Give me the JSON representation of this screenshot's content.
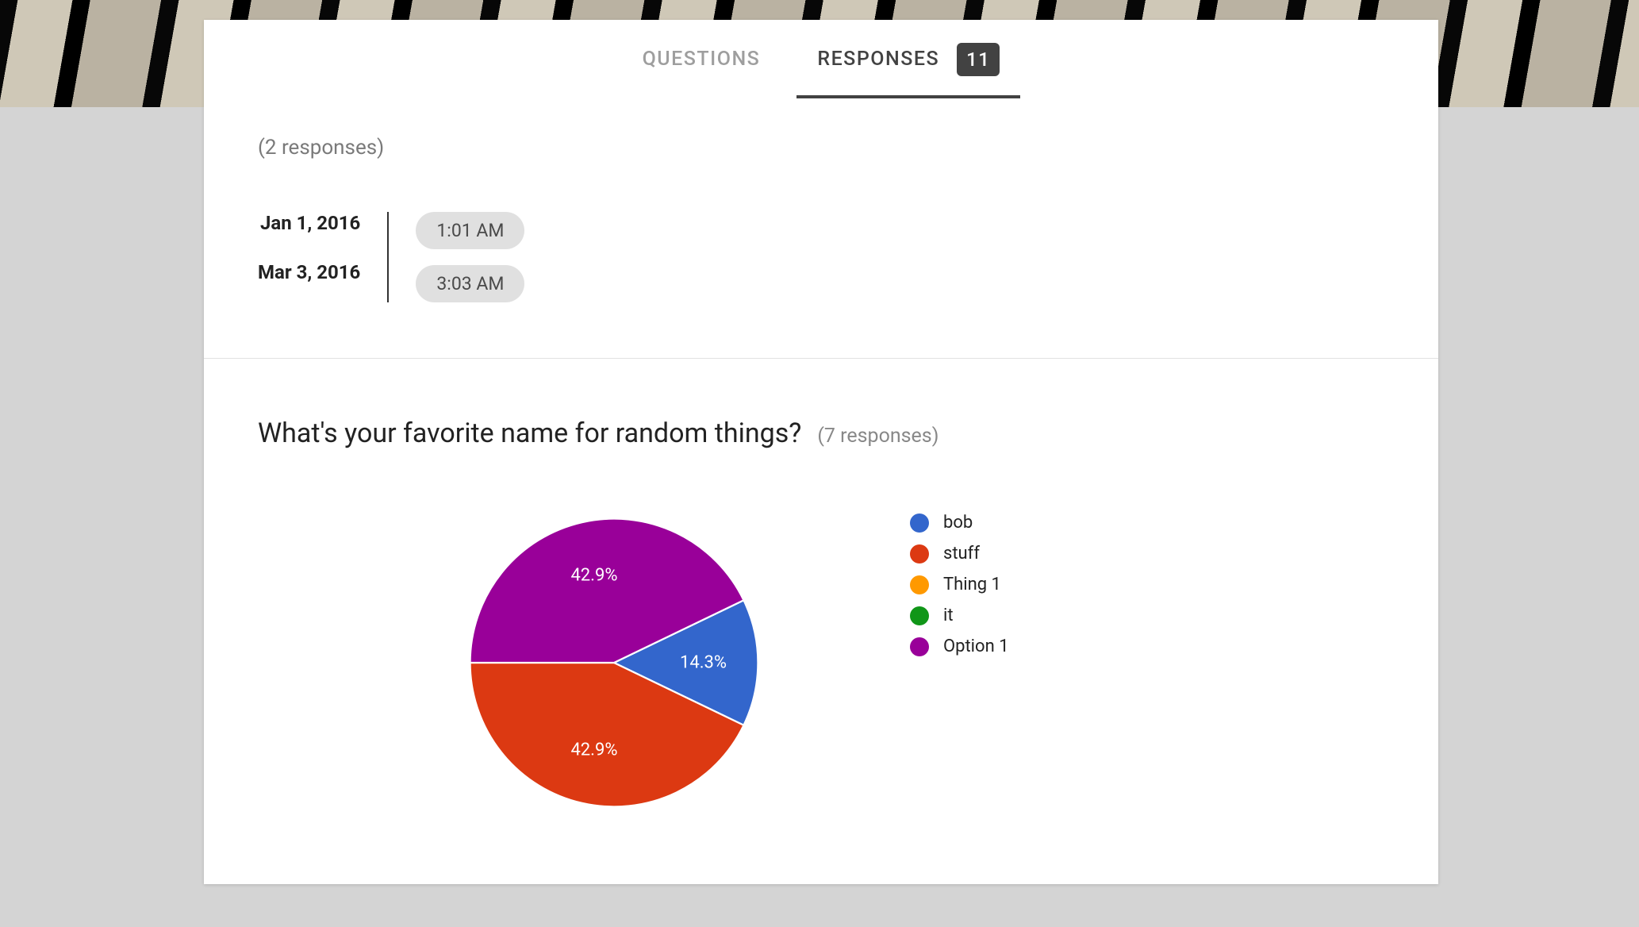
{
  "tabs": {
    "questions": "QUESTIONS",
    "responses": "RESPONSES",
    "badge": "11"
  },
  "section1": {
    "count_label": "(2 responses)",
    "rows": [
      {
        "date": "Jan 1, 2016",
        "time": "1:01 AM"
      },
      {
        "date": "Mar 3, 2016",
        "time": "3:03 AM"
      }
    ]
  },
  "section2": {
    "title": "What's your favorite name for random things?",
    "count_label": "(7 responses)"
  },
  "chart_data": {
    "type": "pie",
    "title": "What's your favorite name for random things?",
    "series": [
      {
        "name": "bob",
        "value": 1,
        "pct": "14.3%",
        "color": "#3366cc"
      },
      {
        "name": "stuff",
        "value": 3,
        "pct": "42.9%",
        "color": "#dc3912"
      },
      {
        "name": "Thing 1",
        "value": 0,
        "pct": "0%",
        "color": "#ff9900"
      },
      {
        "name": "it",
        "value": 0,
        "pct": "0%",
        "color": "#109618"
      },
      {
        "name": "Option 1",
        "value": 3,
        "pct": "42.9%",
        "color": "#990099"
      }
    ],
    "legend_position": "right",
    "labels_visible": [
      "14.3%",
      "42.9%",
      "42.9%"
    ]
  }
}
